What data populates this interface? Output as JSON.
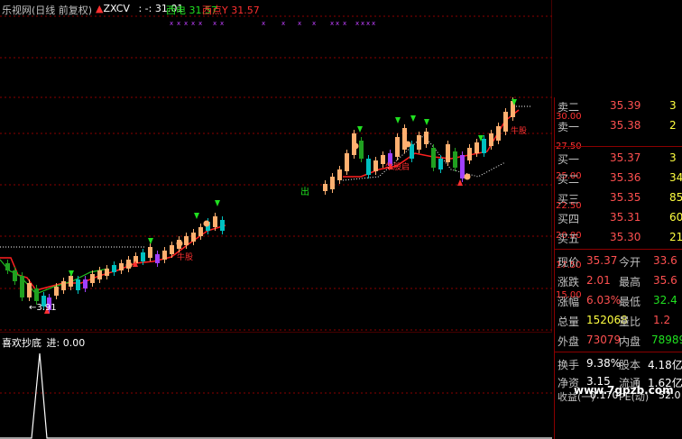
{
  "header": {
    "title": "乐视网(日线 前复权)",
    "indicator_name": "ZXCV",
    "indicator_value": ": -: 31.01",
    "buy_label": "西电",
    "buy_value": "31.57",
    "sell_label": "西点Y",
    "sell_value": "31.57"
  },
  "colors": {
    "background": "#000000",
    "grid": "#8b0000",
    "up_candle": "#ffb070",
    "down_candle": "#00c0c0",
    "support_line": "#ff2020",
    "resistance_line": "#20c020",
    "purple": "#a040ff"
  },
  "main_chart": {
    "min_label": "3.91",
    "signal_label": "出",
    "red_tags": [
      "牛股",
      "牛股启",
      "牛股",
      "牛股"
    ]
  },
  "y_axis": {
    "labels": [
      "30.00",
      "27.50",
      "25.00",
      "22.50",
      "20.00",
      "17.50",
      "15.00"
    ]
  },
  "sub_chart": {
    "title": "喜欢抄底",
    "series_label": "进",
    "series_value": "0.00"
  },
  "quote_panel": {
    "asks": [
      {
        "label": "卖二",
        "price": "35.39",
        "vol": "3"
      },
      {
        "label": "卖一",
        "price": "35.38",
        "vol": "2"
      }
    ],
    "bids": [
      {
        "label": "买一",
        "price": "35.37",
        "vol": "3"
      },
      {
        "label": "买二",
        "price": "35.36",
        "vol": "34"
      },
      {
        "label": "买三",
        "price": "35.35",
        "vol": "85"
      },
      {
        "label": "买四",
        "price": "35.31",
        "vol": "60"
      },
      {
        "label": "买五",
        "price": "35.30",
        "vol": "210"
      }
    ],
    "stats": [
      {
        "l1": "现价",
        "v1": "35.37",
        "l2": "今开",
        "v2": "33.6"
      },
      {
        "l1": "涨跌",
        "v1": "2.01",
        "l2": "最高",
        "v2": "35.6"
      },
      {
        "l1": "涨幅",
        "v1": "6.03%",
        "l2": "最低",
        "v2": "32.4"
      },
      {
        "l1": "总量",
        "v1": "152068",
        "l2": "量比",
        "v2": "1.2"
      },
      {
        "l1": "外盘",
        "v1": "73079",
        "l2": "内盘",
        "v2": "78989"
      }
    ],
    "extra": [
      {
        "l1": "换手",
        "v1": "9.38%",
        "l2": "股本",
        "v2": "4.18亿"
      },
      {
        "l1": "净资",
        "v1": "3.15",
        "l2": "流通",
        "v2": "1.62亿"
      },
      {
        "l1": "收益(一)",
        "v1": "0.170",
        "l2": "PE(动)",
        "v2": "52.0"
      }
    ]
  },
  "watermark": "www.7gpzb.com"
}
